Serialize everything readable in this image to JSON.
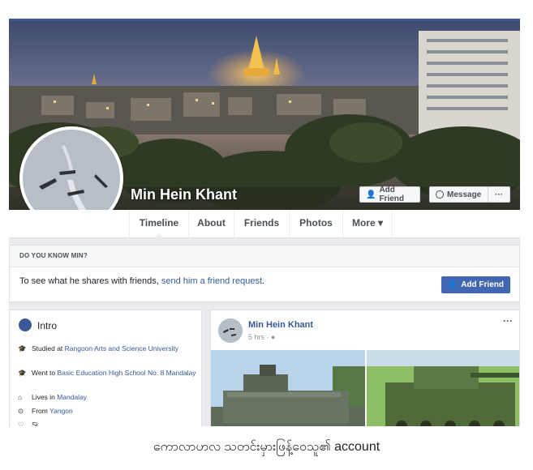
{
  "profile": {
    "name": "Min Hein Khant",
    "add_friend_label": "Add Friend",
    "message_label": "Message",
    "more_dots": "···"
  },
  "nav": {
    "tabs": [
      "Timeline",
      "About",
      "Friends",
      "Photos",
      "More ▾"
    ]
  },
  "know_card": {
    "heading": "DO YOU KNOW MIN?",
    "text_prefix": "To see what he shares with friends, ",
    "link_text": "send him a friend request",
    "text_suffix": ".",
    "button_label": "Add Friend"
  },
  "intro": {
    "title": "Intro",
    "items": [
      {
        "icon": "cap-icon",
        "prefix": "Studied at ",
        "link": "Rangoon Arts and Science University"
      },
      {
        "icon": "cap-icon",
        "prefix": "Went to ",
        "link": "Basic Education High School No. 8 Mandalay"
      },
      {
        "icon": "home-icon",
        "prefix": "Lives in ",
        "link": "Mandalay"
      },
      {
        "icon": "pin-icon",
        "prefix": "From ",
        "link": "Yangon"
      },
      {
        "icon": "heart-icon",
        "prefix": "Si",
        "link": ""
      }
    ]
  },
  "post": {
    "author": "Min Hein Khant",
    "time": "5 hrs · ",
    "more": "···"
  },
  "caption": "ကောလာဟလ သတင်းမှားဖြန့်ဝေသူ၏ account",
  "colors": {
    "brand": "#3b5998",
    "button_blue": "#4267b2",
    "link": "#365899"
  }
}
